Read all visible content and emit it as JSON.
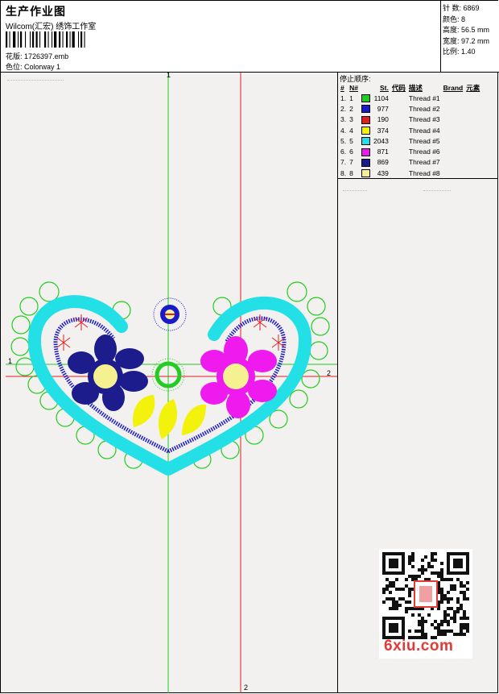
{
  "header": {
    "title": "生产作业图",
    "company": "Wilcom(汇宏) 绣饰工作室",
    "pattern_label": "花版:",
    "pattern_value": "1726397.emb",
    "colorway_label": "色位:",
    "colorway_value": "Colorway 1"
  },
  "stats": {
    "stitches_label": "针 数:",
    "stitches_value": "6869",
    "colors_label": "颜色:",
    "colors_value": "8",
    "height_label": "高度:",
    "height_value": "56.5 mm",
    "width_label": "宽度:",
    "width_value": "97.2 mm",
    "scale_label": "比例:",
    "scale_value": "1.40"
  },
  "stop_sequence": {
    "title": "停止顺序:",
    "headers": [
      "#",
      "N#",
      "St.",
      "代码",
      "描述",
      "Brand",
      "元素"
    ],
    "rows": [
      {
        "idx": "1.",
        "n": "1",
        "color": "#22cc22",
        "st": "1104",
        "desc": "Thread #1"
      },
      {
        "idx": "2.",
        "n": "2",
        "color": "#1a1ac8",
        "st": "977",
        "desc": "Thread #2"
      },
      {
        "idx": "3.",
        "n": "3",
        "color": "#e02020",
        "st": "190",
        "desc": "Thread #3"
      },
      {
        "idx": "4.",
        "n": "4",
        "color": "#f2f20a",
        "st": "374",
        "desc": "Thread #4"
      },
      {
        "idx": "5.",
        "n": "5",
        "color": "#22e0e6",
        "st": "2043",
        "desc": "Thread #5"
      },
      {
        "idx": "6.",
        "n": "6",
        "color": "#ee1aee",
        "st": "871",
        "desc": "Thread #6"
      },
      {
        "idx": "7.",
        "n": "7",
        "color": "#1c1c8c",
        "st": "869",
        "desc": "Thread #7"
      },
      {
        "idx": "8.",
        "n": "8",
        "color": "#f5f090",
        "st": "439",
        "desc": "Thread #8"
      }
    ]
  },
  "axes": {
    "v_label_top": "1",
    "v_label_bottom": "2",
    "h_label_left": "1",
    "h_label_right": "2"
  },
  "watermark": "6xiu.com",
  "colors": {
    "green": "#22cc22",
    "blue": "#1a1ac8",
    "red": "#e02020",
    "yellow": "#f2f20a",
    "cyan": "#22e0e6",
    "magenta": "#ee1aee",
    "navy": "#1c1c8c",
    "light_yellow": "#f5f090"
  }
}
